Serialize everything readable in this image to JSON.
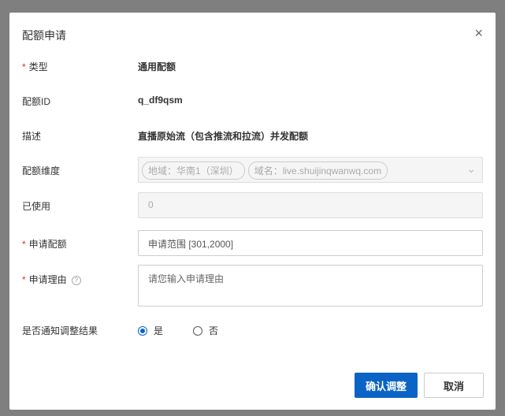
{
  "dialog": {
    "title": "配额申请",
    "close": "×"
  },
  "fields": {
    "type_label": "类型",
    "type_value": "通用配额",
    "id_label": "配额ID",
    "id_value": "q_df9qsm",
    "desc_label": "描述",
    "desc_value": "直播原始流（包含推流和拉流）并发配额",
    "dim_label": "配额维度",
    "dim_tags": [
      "地域：华南1（深圳）",
      "域名：live.shuijinqwanwq.com"
    ],
    "used_label": "已使用",
    "used_value": "0",
    "apply_label": "申请配额",
    "apply_placeholder": "申请范围 [301,2000]",
    "reason_label": "申请理由",
    "reason_placeholder": "请您输入申请理由",
    "notify_label": "是否通知调整结果",
    "notify_yes": "是",
    "notify_no": "否"
  },
  "buttons": {
    "confirm": "确认调整",
    "cancel": "取消"
  },
  "required_mark": "*"
}
